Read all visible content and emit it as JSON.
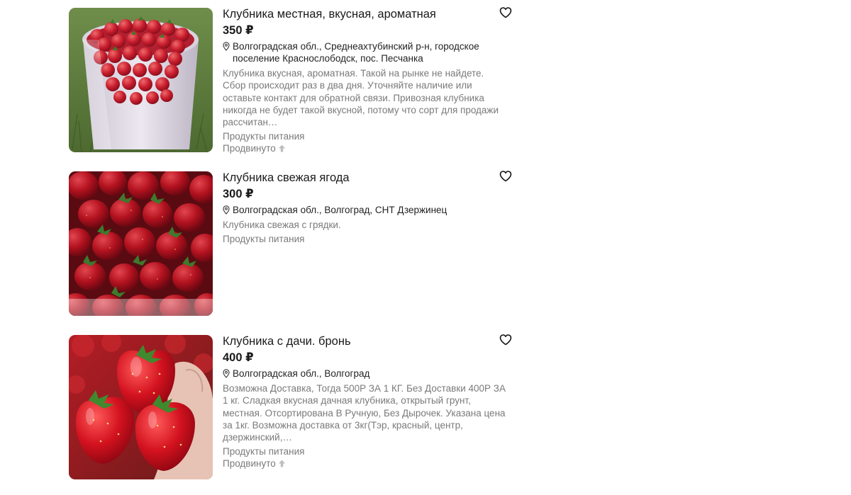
{
  "listings": [
    {
      "title": "Клубника местная, вкусная, ароматная",
      "price": "350 ₽",
      "address": "Волгоградская обл., Среднеахтубинский р-н, городское поселение Краснослободск, пос. Песчанка",
      "description": "Клубника вкусная, ароматная. Такой на рынке не найдете. Сбор происходит раз в два дня. Уточняйте наличие или оставьте контакт для обратной связи. Привозная клубника никогда не будет такой вкусной, потому что сорт для продажи рассчитан…",
      "category": "Продукты питания",
      "promoted": "Продвинуто",
      "image": "strawberries-in-bucket"
    },
    {
      "title": "Клубника свежая ягода",
      "price": "300 ₽",
      "address": "Волгоградская обл., Волгоград, СНТ Дзержинец",
      "description": "Клубника свежая с грядки.",
      "category": "Продукты питания",
      "promoted": "",
      "image": "strawberries-closeup"
    },
    {
      "title": "Клубника с дачи. бронь",
      "price": "400 ₽",
      "address": "Волгоградская обл., Волгоград",
      "description": "Возможна Доставка, Тогда 500Р ЗА 1 КГ. Без Доставки 400Р ЗА 1 кг. Сладкая вкусная дачная клубника, открытый грунт, местная. Отсортирована В Ручную, Без Дырочек. Указана цена за 1кг. Возможна доставка от 3кг(Тэр, красный, центр, дзержинский,…",
      "category": "Продукты питания",
      "promoted": "Продвинуто",
      "image": "strawberries-in-hand"
    }
  ],
  "icons": {
    "favorite": "heart-outline-icon",
    "location": "location-pin-icon",
    "promoted": "arrow-up-icon"
  },
  "colors": {
    "text": "#1a1a1a",
    "muted": "#7a7a7a",
    "strawberry": "#c8102e"
  }
}
